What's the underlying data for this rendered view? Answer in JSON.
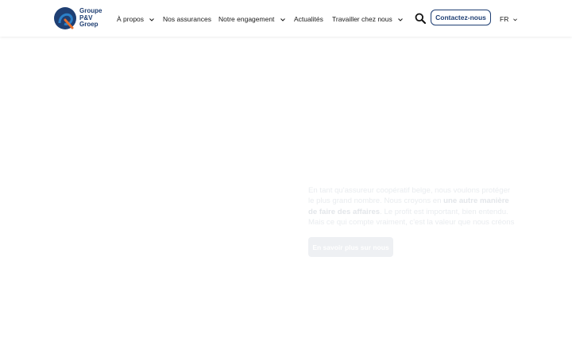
{
  "brand": {
    "line1": "Groupe",
    "line2": "P&V",
    "line3": "Groep",
    "colors": {
      "navy": "#1f3f73",
      "blue": "#2c7fc7",
      "orange": "#e76f2c"
    }
  },
  "nav": {
    "items": [
      {
        "label": "À propos",
        "has_dropdown": true
      },
      {
        "label": "Nos assurances",
        "has_dropdown": false
      },
      {
        "label": "Notre engagement",
        "has_dropdown": true
      },
      {
        "label": "Actualités",
        "has_dropdown": false
      },
      {
        "label": "Travailler chez nous",
        "has_dropdown": true
      }
    ],
    "search_icon": "search-icon",
    "contact_label": "Contactez-nous",
    "language": "FR"
  },
  "hero": {
    "text_part1": "En tant qu'assureur coopératif belge, nous voulons protéger le plus grand nombre. Nous croyons en ",
    "text_bold": "une autre manière de faire des affaires",
    "text_part2": ". Le profit est important, bien entendu. Mais ce qui compte vraiment, c'est la valeur que nous créons",
    "button_label": "En savoir plus sur nous"
  }
}
